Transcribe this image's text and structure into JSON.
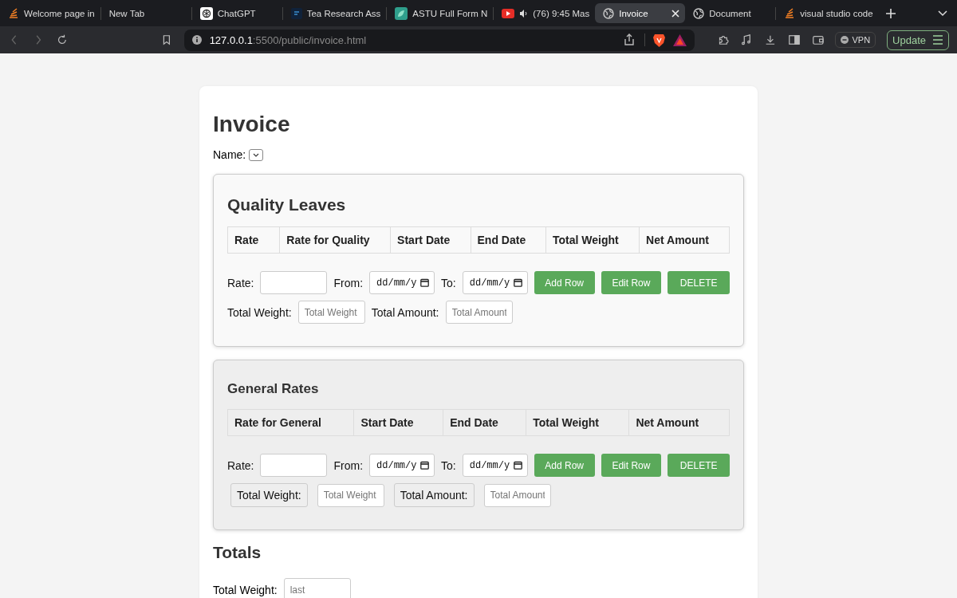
{
  "browser": {
    "tabs": [
      {
        "title": "Welcome page in",
        "selected": false
      },
      {
        "title": "New Tab",
        "selected": false
      },
      {
        "title": "ChatGPT",
        "selected": false
      },
      {
        "title": "Tea Research Ass",
        "selected": false
      },
      {
        "title": "ASTU Full Form N",
        "selected": false
      },
      {
        "title": "(76) 9:45 Mas",
        "selected": false
      },
      {
        "title": "Invoice",
        "selected": true
      },
      {
        "title": "Document",
        "selected": false
      },
      {
        "title": "visual studio code",
        "selected": false
      }
    ],
    "url_host": "127.0.0.1",
    "url_path": ":5500/public/invoice.html",
    "vpn": "VPN",
    "update": "Update"
  },
  "page": {
    "title": "Invoice",
    "name_label": "Name:",
    "sections": [
      {
        "title": "Quality Leaves",
        "boxed_labels": false,
        "columns": [
          "Rate",
          "Rate for Quality",
          "Start Date",
          "End Date",
          "Total Weight",
          "Net Amount"
        ],
        "rate_label": "Rate:",
        "from_label": "From:",
        "from_placeholder": "dd/mm/y",
        "to_label": "To:",
        "to_placeholder": "dd/mm/y",
        "buttons": [
          "Add Row",
          "Edit Row",
          "DELETE"
        ],
        "weight_label": "Total Weight:",
        "weight_placeholder": "Total Weight",
        "amount_label": "Total Amount:",
        "amount_placeholder": "Total Amount"
      },
      {
        "title": "General Rates",
        "boxed_labels": true,
        "columns": [
          "Rate for General",
          "Start Date",
          "End Date",
          "Total Weight",
          "Net Amount"
        ],
        "rate_label": "Rate:",
        "from_label": "From:",
        "from_placeholder": "dd/mm/y",
        "to_label": "To:",
        "to_placeholder": "dd/mm/y",
        "buttons": [
          "Add Row",
          "Edit Row",
          "DELETE"
        ],
        "weight_label": "Total Weight:",
        "weight_placeholder": "Total Weight",
        "amount_label": "Total Amount:",
        "amount_placeholder": "Total Amount"
      }
    ],
    "totals_title": "Totals",
    "totals_weight_label": "Total Weight:",
    "totals_weight_placeholder": "last"
  }
}
